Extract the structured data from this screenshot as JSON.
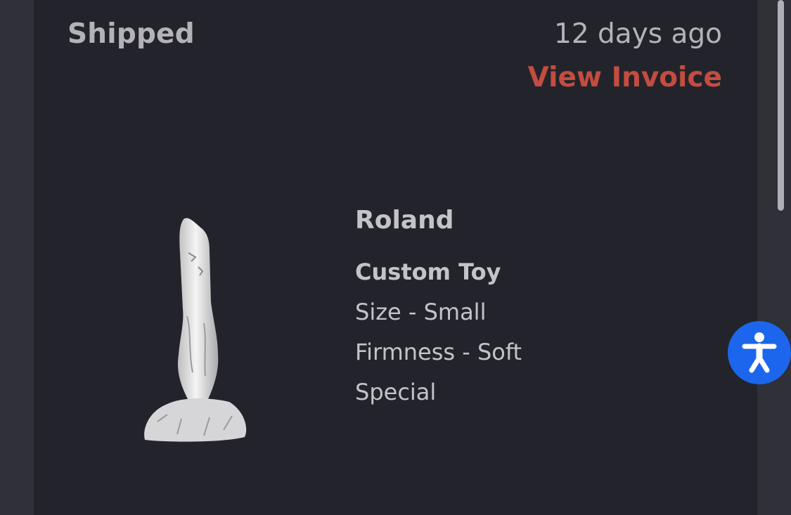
{
  "order": {
    "status": "Shipped",
    "time_ago": "12 days ago",
    "invoice_link": "View Invoice"
  },
  "product": {
    "name": "Roland",
    "type": "Custom Toy",
    "options": [
      "Size - Small",
      "Firmness - Soft",
      "Special"
    ]
  },
  "accessibility": {
    "icon": "accessibility-person-icon"
  },
  "colors": {
    "accent": "#c44c40",
    "accessibility_button": "#1b66ec",
    "card_background": "#23242b"
  }
}
